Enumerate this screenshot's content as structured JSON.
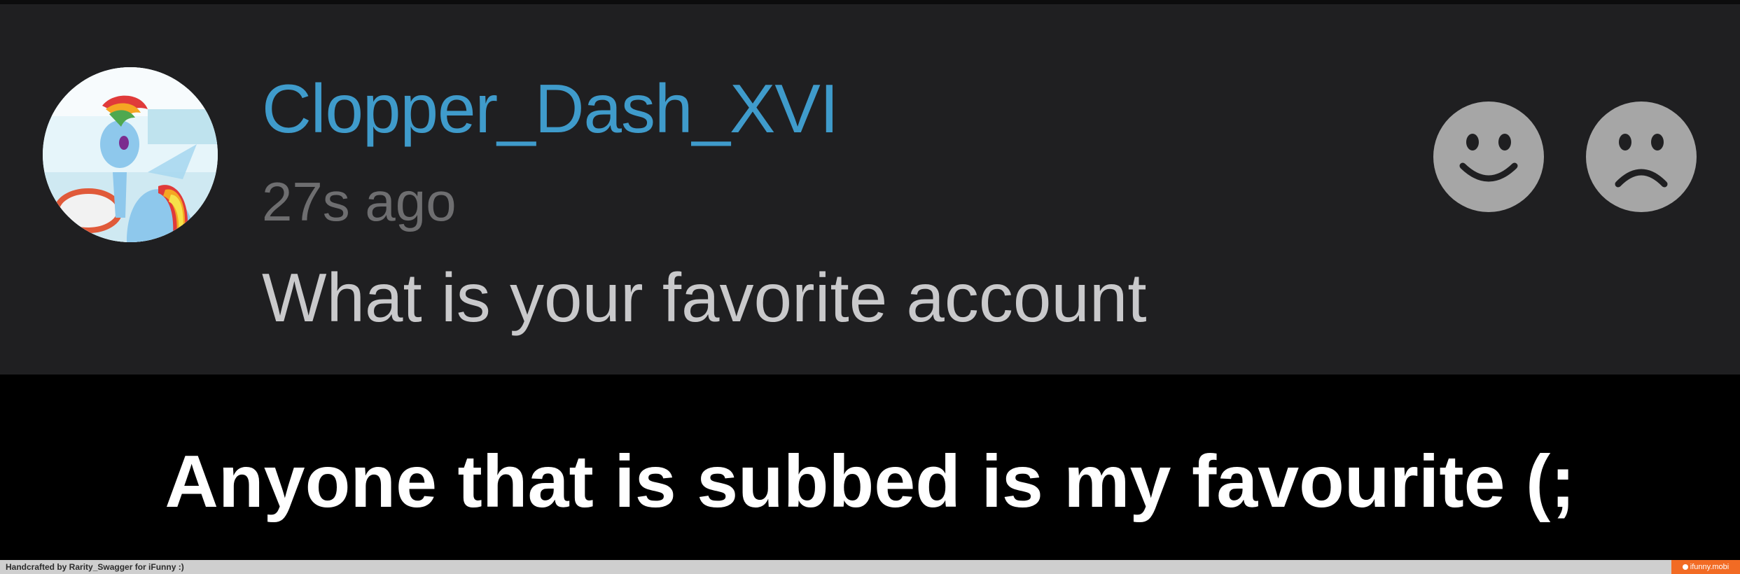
{
  "comment": {
    "username": "Clopper_Dash_XVI",
    "timestamp": "27s ago",
    "text": "What is your favorite account"
  },
  "icons": {
    "avatar": "pony-avatar",
    "like": "smile-face-icon",
    "dislike": "sad-face-icon"
  },
  "caption": "Anyone that is subbed is my favourite (;",
  "footer": {
    "credit": "Handcrafted by Rarity_Swagger for iFunny :)",
    "badge": "ifunny.mobi"
  },
  "colors": {
    "card_background": "#1f1f21",
    "username": "#3f9bcb",
    "timestamp": "#6e6e70",
    "comment_text": "#c9c9cb",
    "vote_icon": "#a6a6a6",
    "badge": "#f26b24"
  }
}
